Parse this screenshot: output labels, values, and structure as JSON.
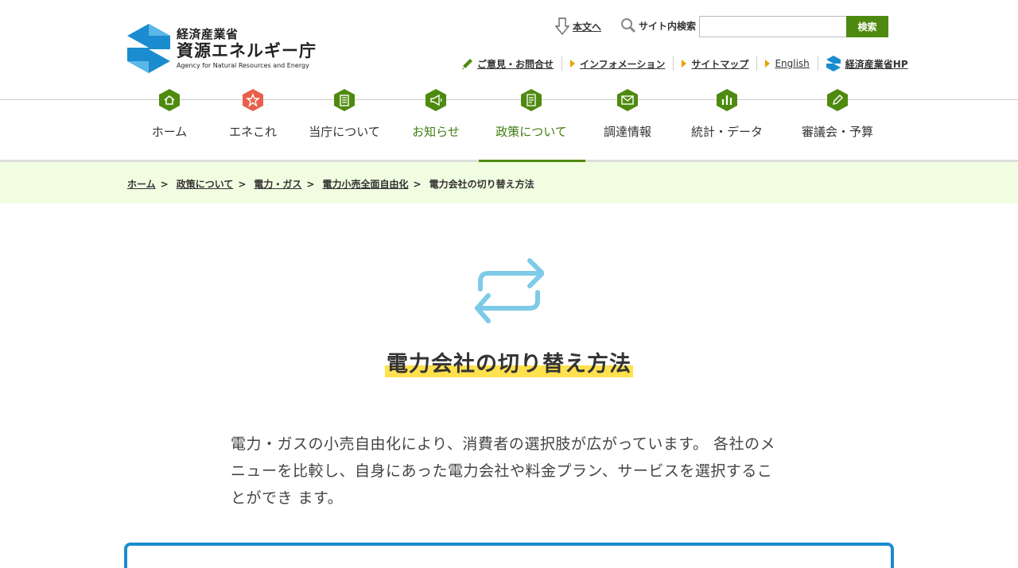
{
  "header": {
    "logo": {
      "ministry": "経済産業省",
      "agency": "資源エネルギー庁",
      "english": "Agency for Natural Resources and Energy"
    },
    "skip_label": "本文へ",
    "search_label": "サイト内検索",
    "search_value": "",
    "search_button": "検索",
    "util_links": [
      {
        "label": "ご意見・お問合せ",
        "icon": "pencil-icon"
      },
      {
        "label": "インフォメーション",
        "icon": "triangle-right-icon"
      },
      {
        "label": "サイトマップ",
        "icon": "triangle-right-icon"
      },
      {
        "label": "English",
        "icon": "triangle-right-icon"
      },
      {
        "label": "経済産業省HP",
        "icon": "meti-logo-icon"
      }
    ]
  },
  "gnav": {
    "items": [
      {
        "label": "ホーム",
        "icon": "home-icon",
        "color": "#4f8a10"
      },
      {
        "label": "エネこれ",
        "icon": "star-icon",
        "color": "#e8604c"
      },
      {
        "label": "当庁について",
        "icon": "building-icon",
        "color": "#4f8a10"
      },
      {
        "label": "お知らせ",
        "icon": "megaphone-icon",
        "color": "#4f8a10"
      },
      {
        "label": "政策について",
        "icon": "document-icon",
        "color": "#4f8a10"
      },
      {
        "label": "調達情報",
        "icon": "mail-icon",
        "color": "#4f8a10"
      },
      {
        "label": "統計・データ",
        "icon": "bar-chart-icon",
        "color": "#4f8a10"
      },
      {
        "label": "審議会・予算",
        "icon": "edit-icon",
        "color": "#4f8a10"
      }
    ],
    "active_index": 4
  },
  "breadcrumb": {
    "items": [
      "ホーム",
      "政策について",
      "電力・ガス",
      "電力小売全面自由化"
    ],
    "separator": ">",
    "current": "電力会社の切り替え方法"
  },
  "main": {
    "title": "電力会社の切り替え方法",
    "lead": "電力・ガスの小売自由化により、消費者の選択肢が広がっています。 各社のメニューを比較し、自身にあった電力会社や料金プラン、サービスを選択することができ ます。"
  },
  "colors": {
    "brand_green": "#4f8a10",
    "breadcrumb_bg": "#f1fde0",
    "title_highlight": "#ffe04d",
    "hero_icon": "#7ecbe8",
    "box_border": "#1a8ccf"
  }
}
